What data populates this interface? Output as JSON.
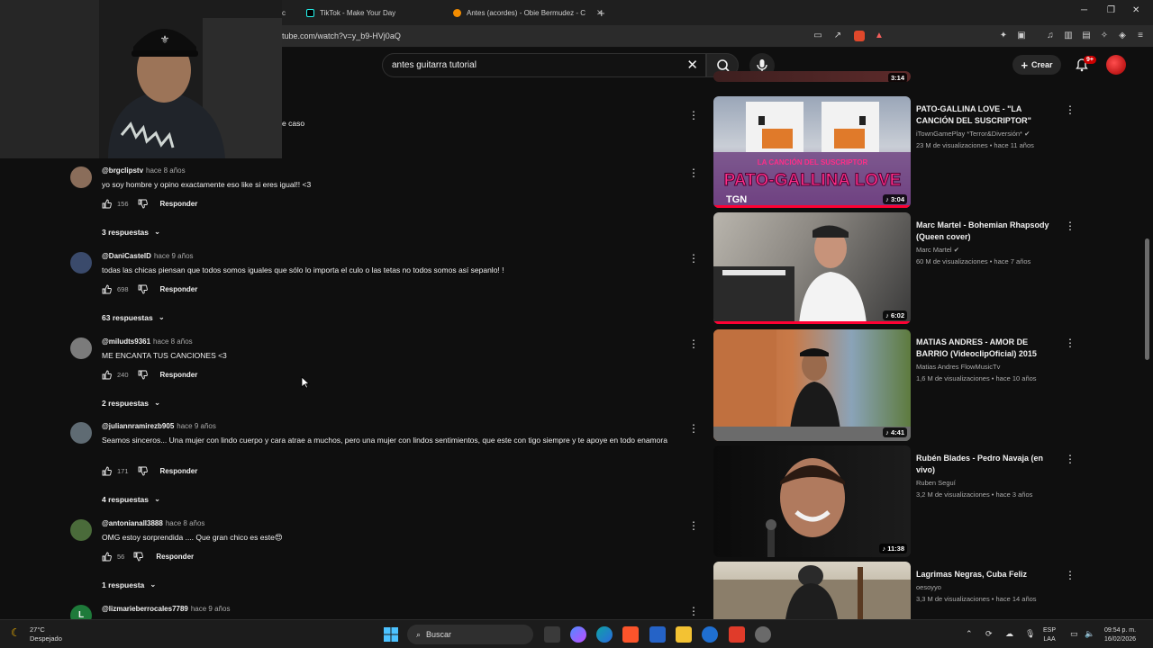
{
  "browser": {
    "tabs": [
      {
        "label": "c",
        "icon": "tab-icon"
      },
      {
        "label": "TikTok - Make Your Day",
        "icon": "tiktok-icon"
      },
      {
        "label": "Antes (acordes) - Obie Bermudez - C",
        "icon": "cifraclub-icon"
      }
    ],
    "url": "tube.com/watch?v=y_b9-HVj0aQ"
  },
  "youtube": {
    "search_value": "antes guitarra tutorial",
    "crear_label": "Crear",
    "notification_count": "9+"
  },
  "comments": [
    {
      "author": "",
      "time": "",
      "text": "e caso",
      "likes": "",
      "replies": ""
    },
    {
      "author": "@brgclipstv",
      "time": "hace 8 años",
      "text": "yo soy hombre y opino exactamente eso like si eres igual!! <3",
      "likes": "156",
      "replies": "3 respuestas",
      "avatar_color": "#8a6d5a"
    },
    {
      "author": "@DaniCastelD",
      "time": "hace 9 años",
      "text": "todas las chicas piensan que todos somos iguales que sólo lo importa el culo o las tetas no todos somos así sepanlo! !",
      "likes": "698",
      "replies": "63 respuestas",
      "avatar_color": "#3a4a6b"
    },
    {
      "author": "@miludts9361",
      "time": "hace 8 años",
      "text": "ME ENCANTA TUS CANCIONES <3",
      "likes": "240",
      "replies": "2 respuestas",
      "avatar_color": "#7b7b7b"
    },
    {
      "author": "@juliannramirezb905",
      "time": "hace 9 años",
      "text": "Seamos sinceros... Una mujer con lindo cuerpo y cara atrae a muchos, pero una mujer con lindos sentimientos, que este con tigo siempre y te apoye en todo enamora",
      "likes": "171",
      "replies": "4 respuestas",
      "avatar_color": "#5f6b73"
    },
    {
      "author": "@antonianall3888",
      "time": "hace 8 años",
      "text": "OMG estoy sorprendida .... Que gran chico es este😍",
      "likes": "56",
      "replies": "1 respuesta",
      "avatar_color": "#4a6b3a"
    },
    {
      "author": "@lizmarieberrocales7789",
      "time": "hace 9 años",
      "text": "",
      "likes": "",
      "replies": "",
      "avatar_color": "#1e7a3a",
      "avatar_letter": "L"
    }
  ],
  "labels": {
    "reply": "Responder"
  },
  "recommended": [
    {
      "title": "",
      "channel": "",
      "meta": "",
      "duration": "3:14"
    },
    {
      "title": "PATO-GALLINA LOVE - \"LA CANCIÓN DEL SUSCRIPTOR\"",
      "channel": "iTownGamePlay *Terror&Diversión*",
      "meta": "23 M de visualizaciones • hace 11 años",
      "duration": "3:04",
      "thumb_text": "PATO-GALLINA LOVE",
      "thumb_sub": "LA CANCIÓN DEL SUSCRIPTOR",
      "thumb_logo": "TGN",
      "verified": true
    },
    {
      "title": "Marc Martel - Bohemian Rhapsody (Queen cover)",
      "channel": "Marc Martel",
      "meta": "60 M de visualizaciones • hace 7 años",
      "duration": "6:02",
      "verified": true
    },
    {
      "title": "MATIAS ANDRES - AMOR DE BARRIO (VideoclipOficial) 2015",
      "channel": "Matias Andres FlowMusicTv",
      "meta": "1,6 M de visualizaciones • hace 10 años",
      "duration": "4:41"
    },
    {
      "title": "Rubén Blades - Pedro Navaja (en vivo)",
      "channel": "Ruben Seguí",
      "meta": "3,2 M de visualizaciones • hace 3 años",
      "duration": "11:38"
    },
    {
      "title": "Lagrimas Negras, Cuba Feliz",
      "channel": "oesoyyo",
      "meta": "3,3 M de visualizaciones • hace 14 años",
      "duration": ""
    }
  ],
  "taskbar": {
    "temp": "27°C",
    "weather": "Despejado",
    "search": "Buscar",
    "lang1": "ESP",
    "lang2": "LAA",
    "time": "09:54 p. m.",
    "date": "16/02/2026"
  },
  "colors": {
    "bg": "#0f0f0f",
    "accent": "#ff0033",
    "text": "#f1f1f1",
    "muted": "#aaaaaa"
  }
}
